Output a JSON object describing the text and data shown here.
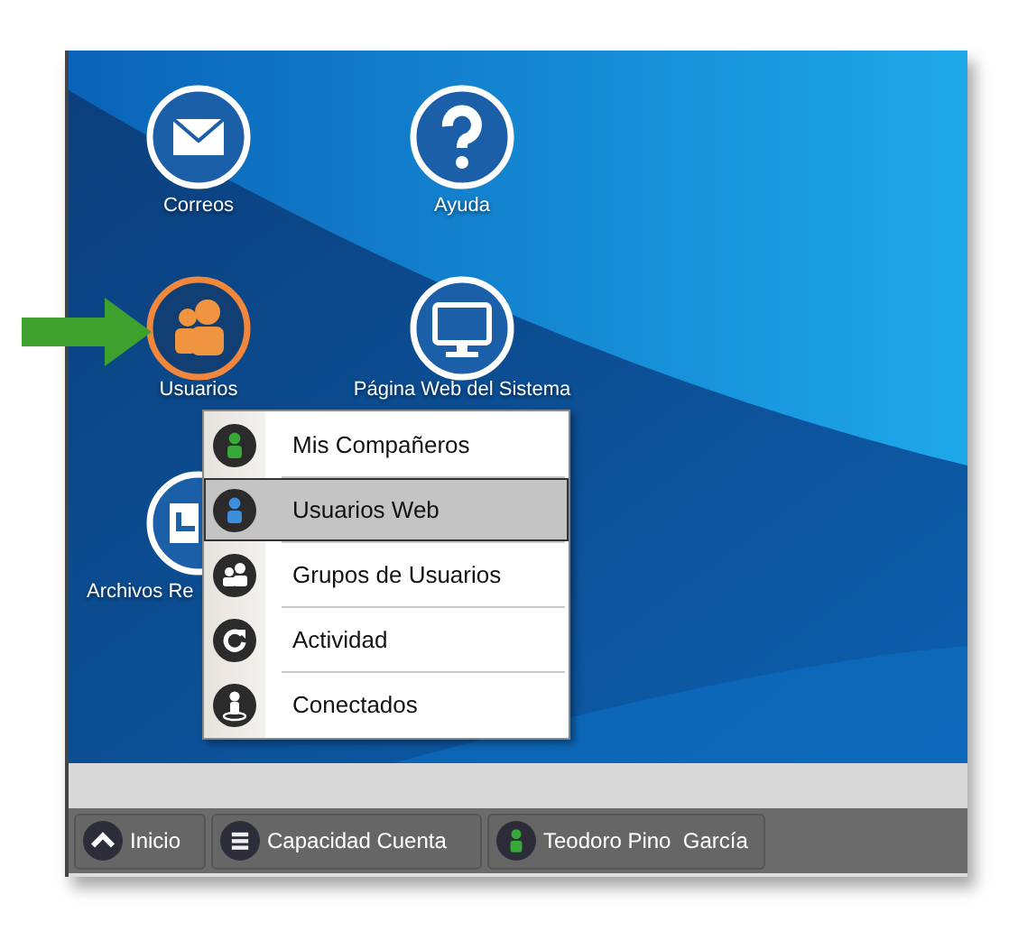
{
  "desktop_icons": [
    {
      "label": "Correos",
      "kind": "mail",
      "selected": false
    },
    {
      "label": "Ayuda",
      "kind": "help",
      "selected": false
    },
    {
      "label": "Usuarios",
      "kind": "users",
      "selected": true
    },
    {
      "label": "Página Web del Sistema",
      "kind": "monitor",
      "selected": false
    },
    {
      "label": "Archivos Re",
      "kind": "files",
      "selected": false
    }
  ],
  "context_menu": {
    "items": [
      {
        "label": "Mis Compañeros",
        "kind": "user-green",
        "selected": false
      },
      {
        "label": "Usuarios Web",
        "kind": "user-blue",
        "selected": true
      },
      {
        "label": "Grupos de Usuarios",
        "kind": "group",
        "selected": false
      },
      {
        "label": "Actividad",
        "kind": "refresh",
        "selected": false
      },
      {
        "label": "Conectados",
        "kind": "connected",
        "selected": false
      }
    ]
  },
  "taskbar": {
    "buttons": [
      {
        "label": "Inicio",
        "kind": "up"
      },
      {
        "label": "Capacidad Cuenta",
        "kind": "list"
      },
      {
        "label": "Teodoro Pino  García",
        "kind": "user"
      }
    ]
  }
}
